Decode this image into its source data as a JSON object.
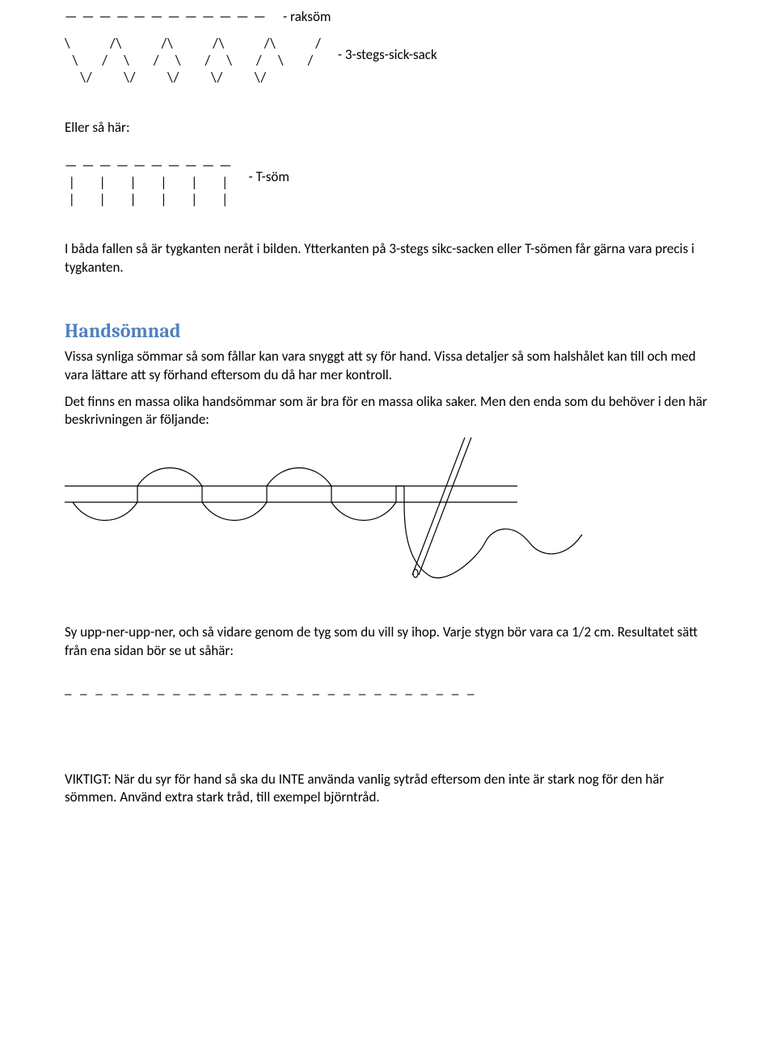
{
  "stitches": {
    "raksom": {
      "ascii": "— — — — — — — — — — — —",
      "label": "- raksöm"
    },
    "zigzag": {
      "ascii": "\\          /\\          /\\          /\\          /\\          /\n  \\      /    \\      /    \\      /    \\      /    \\      /\n    \\/        \\/        \\/        \\/        \\/",
      "label": "- 3-stegs-sick-sack"
    },
    "tsom": {
      "ascii": "— — — — — — — — — —\n |      |      |      |      |      |\n |      |      |      |      |      |",
      "label": "- T-söm"
    },
    "dashline": "_  _  _  _  _  _  _  _  _  _  _  _  _  _  _  _  _  _  _  _  _  _  _  _  _  _  _"
  },
  "text": {
    "eller": "Eller så här:",
    "para1": "I båda fallen så är tygkanten neråt i bilden. Ytterkanten på 3-stegs sikc-sacken eller T-sömen får gärna vara precis i tygkanten.",
    "heading": "Handsömnad",
    "para2a": "Vissa synliga sömmar så som fållar kan vara snyggt att sy för hand. Vissa detaljer så som halshålet kan till och med vara lättare att sy förhand eftersom du då har mer kontroll.",
    "para2b": "Det finns en massa olika handsömmar som är bra för en massa olika saker. Men den enda som du behöver i den här beskrivningen är följande:",
    "para3": "Sy upp-ner-upp-ner, och så vidare genom de tyg som du vill sy ihop. Varje stygn bör vara ca 1/2 cm. Resultatet sätt från ena sidan bör se ut såhär:",
    "para4": "VIKTIGT: När du syr för hand så ska du INTE använda vanlig sytråd eftersom den inte är stark nog för den här sömmen. Använd extra stark tråd, till exempel björntråd."
  }
}
